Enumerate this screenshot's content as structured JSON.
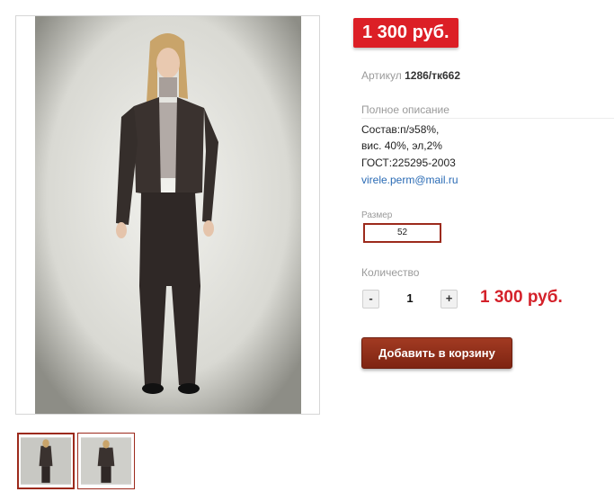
{
  "product": {
    "price_badge": "1 300 руб.",
    "sku_label": "Артикул",
    "sku_value": "1286/тк662",
    "description_title": "Полное описание",
    "description_lines": [
      "Состав:п/э58%,",
      "вис. 40%, эл,2%",
      "ГОСТ:225295-2003"
    ],
    "description_link": "virele.perm@mail.ru",
    "size_title": "Размер",
    "size_selected": "52",
    "quantity_title": "Количество",
    "qty_minus_label": "-",
    "qty_value": "1",
    "qty_plus_label": "+",
    "total_price": "1 300 руб.",
    "add_to_cart_label": "Добавить в корзину"
  },
  "colors": {
    "badge_red": "#dc1f26",
    "price_red": "#d4212a",
    "button_brown": "#8b2c17",
    "link_blue": "#2a6bb5",
    "thumb_border": "#9c2a1c"
  }
}
